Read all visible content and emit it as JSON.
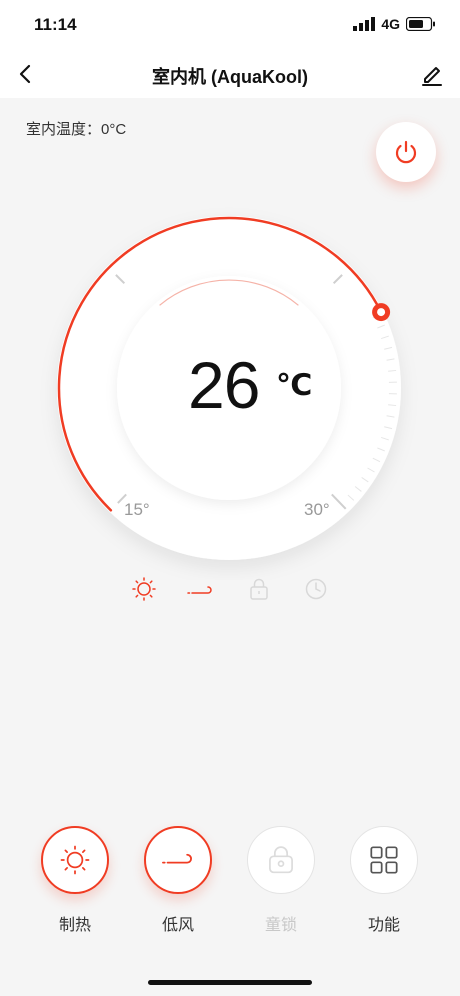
{
  "status_bar": {
    "time": "11:14",
    "network": "4G"
  },
  "header": {
    "title": "室内机 (AquaKool)"
  },
  "indoor": {
    "label": "室内温度：0°C"
  },
  "thermostat": {
    "value": "26",
    "unit": "℃",
    "min_label": "15°",
    "max_label": "30°",
    "min": 15,
    "max": 30,
    "setpoint": 26
  },
  "status_icons": [
    "sun-icon",
    "wind-icon",
    "lock-icon",
    "clock-icon"
  ],
  "controls": [
    {
      "label": "制热",
      "icon": "sun-icon",
      "active": true
    },
    {
      "label": "低风",
      "icon": "wind-icon",
      "active": true
    },
    {
      "label": "童锁",
      "icon": "lock-icon",
      "active": false
    },
    {
      "label": "功能",
      "icon": "grid-icon",
      "active": false
    }
  ],
  "colors": {
    "accent": "#f03c23",
    "background": "#f5f5f5"
  }
}
